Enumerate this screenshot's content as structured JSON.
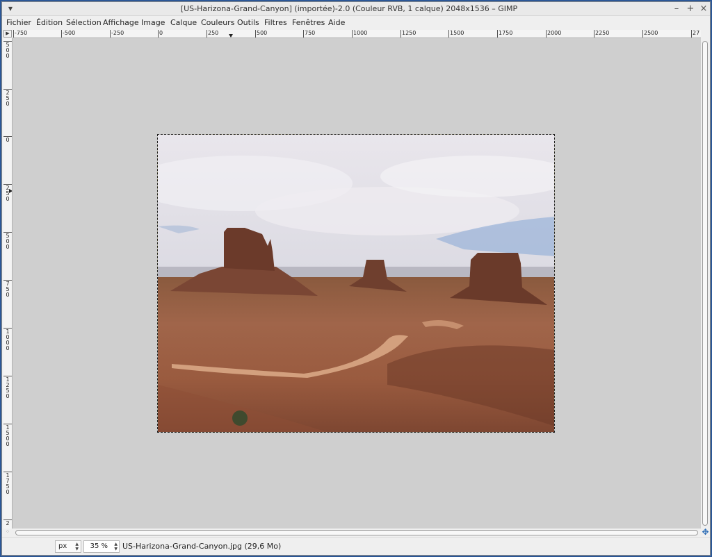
{
  "window": {
    "title": "[US-Harizona-Grand-Canyon] (importée)-2.0 (Couleur RVB, 1 calque) 2048x1536 – GIMP",
    "minimize_label": "–",
    "maximize_label": "+",
    "close_label": "×"
  },
  "menu": {
    "items": [
      "Fichier",
      "Édition",
      "Sélection",
      "Affichage",
      "Image",
      "Calque",
      "Couleurs",
      "Outils",
      "Filtres",
      "Fenêtres",
      "Aide"
    ]
  },
  "rulers": {
    "horizontal_labels": [
      "-750",
      "-500",
      "-250",
      "0",
      "250",
      "500",
      "750",
      "1000",
      "1250",
      "1500",
      "1750",
      "2000",
      "2250",
      "2500",
      "27"
    ],
    "vertical_labels": [
      "500",
      "250",
      "0",
      "250",
      "500",
      "750",
      "1000",
      "1250",
      "1500",
      "1750",
      "2"
    ]
  },
  "canvas": {
    "background_color": "#cfcfcf",
    "image_description_icon": "photo-image"
  },
  "statusbar": {
    "unit": "px",
    "zoom": "35 %",
    "info": "US-Harizona-Grand-Canyon.jpg (29,6 Mo)"
  },
  "colors": {
    "selection_marching_ants": "#e5c400",
    "accent_blue": "#2a6bb5"
  }
}
